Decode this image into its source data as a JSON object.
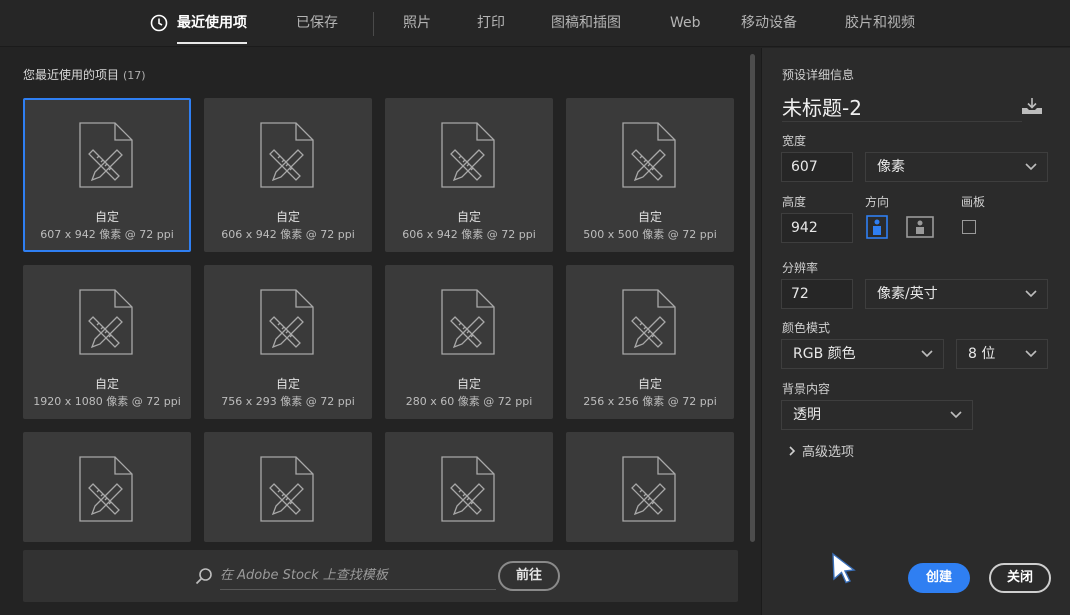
{
  "nav": {
    "tabs": [
      {
        "label": "最近使用项",
        "active": true
      },
      {
        "label": "已保存"
      },
      {
        "label": "照片"
      },
      {
        "label": "打印"
      },
      {
        "label": "图稿和插图"
      },
      {
        "label": "Web"
      },
      {
        "label": "移动设备"
      },
      {
        "label": "胶片和视频"
      }
    ]
  },
  "recent": {
    "title": "您最近使用的项目",
    "count": "(17)",
    "items": [
      {
        "label": "自定",
        "dims": "607 x 942 像素 @ 72 ppi",
        "selected": true
      },
      {
        "label": "自定",
        "dims": "606 x 942 像素 @ 72 ppi"
      },
      {
        "label": "自定",
        "dims": "606 x 942 像素 @ 72 ppi"
      },
      {
        "label": "自定",
        "dims": "500 x 500 像素 @ 72 ppi"
      },
      {
        "label": "自定",
        "dims": "1920 x 1080 像素 @ 72 ppi"
      },
      {
        "label": "自定",
        "dims": "756 x 293 像素 @ 72 ppi"
      },
      {
        "label": "自定",
        "dims": "280 x 60 像素 @ 72 ppi"
      },
      {
        "label": "自定",
        "dims": "256 x 256 像素 @ 72 ppi"
      }
    ]
  },
  "stock": {
    "placeholder": "在 Adobe Stock 上查找模板",
    "go_label": "前往"
  },
  "panel": {
    "heading": "预设详细信息",
    "doc_title": "未标题-2",
    "width_label": "宽度",
    "width_value": "607",
    "width_unit": "像素",
    "height_label": "高度",
    "height_value": "942",
    "orientation_label": "方向",
    "artboard_label": "画板",
    "resolution_label": "分辨率",
    "resolution_value": "72",
    "resolution_unit": "像素/英寸",
    "color_mode_label": "颜色模式",
    "color_mode_value": "RGB 颜色",
    "bit_depth_value": "8 位",
    "background_label": "背景内容",
    "background_value": "透明",
    "advanced_label": "高级选项",
    "create_label": "创建",
    "close_label": "关闭"
  },
  "colors": {
    "accent": "#2f7ff2",
    "background": "#232323",
    "panel": "#2b2b2b",
    "card": "#3a3a3a"
  },
  "icons": [
    "clock-icon",
    "document-icon",
    "search-icon",
    "save-preset-icon",
    "portrait-icon",
    "landscape-icon",
    "chevron-down-icon",
    "chevron-right-icon",
    "cursor-icon"
  ]
}
